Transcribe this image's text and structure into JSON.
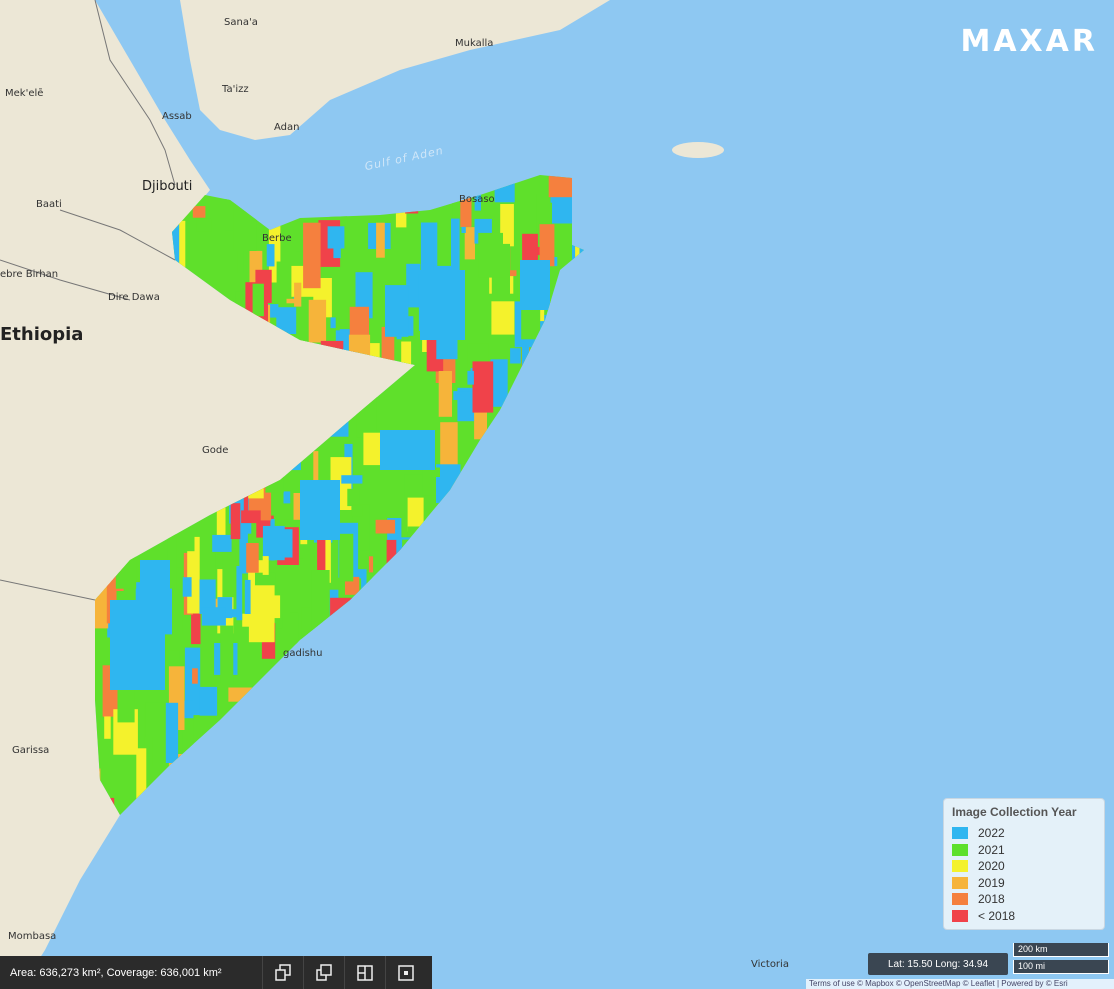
{
  "brand": {
    "logo_text": "MAXAR"
  },
  "places": {
    "sanaa": "Sana'a",
    "mukalla": "Mukalla",
    "mekele": "Mek'elē",
    "taizz": "Ta'izz",
    "assab": "Assab",
    "adan": "Adan",
    "gulf_of_aden": "Gulf of Aden",
    "djibouti": "Djibouti",
    "baati": "Baati",
    "bosaso": "Bosaso",
    "berbera": "Berbe",
    "debre_birhan": "ebre Birhan",
    "dire_dawa": "Dire Dawa",
    "ethiopia": "Ethiopia",
    "gode": "Gode",
    "mogadishu": "gadishu",
    "garissa": "Garissa",
    "mombasa": "Mombasa",
    "victoria": "Victoria"
  },
  "legend": {
    "title": "Image Collection Year",
    "items": [
      {
        "label": "2022",
        "color": "#2fb6f0"
      },
      {
        "label": "2021",
        "color": "#5fe02b"
      },
      {
        "label": "2020",
        "color": "#f4f22c"
      },
      {
        "label": "2019",
        "color": "#f6b43a"
      },
      {
        "label": "2018",
        "color": "#f5803e"
      },
      {
        "label": "< 2018",
        "color": "#f0424a"
      }
    ]
  },
  "status": {
    "area_text": "Area: 636,273 km², Coverage: 636,001 km²",
    "latlong": "Lat: 15.50 Long: 34.94",
    "scale_km": "200 km",
    "scale_mi": "100 mi",
    "attribution": "Terms of use © Mapbox © OpenStreetMap © Leaflet | Powered by © Esri"
  },
  "tools": [
    {
      "icon": "copy-front-icon"
    },
    {
      "icon": "copy-back-icon"
    },
    {
      "icon": "split-view-icon"
    },
    {
      "icon": "frame-select-icon"
    }
  ],
  "colors": {
    "water": "#8ec8f2",
    "land": "#ece7d6",
    "bar": "#2b2b2b"
  }
}
